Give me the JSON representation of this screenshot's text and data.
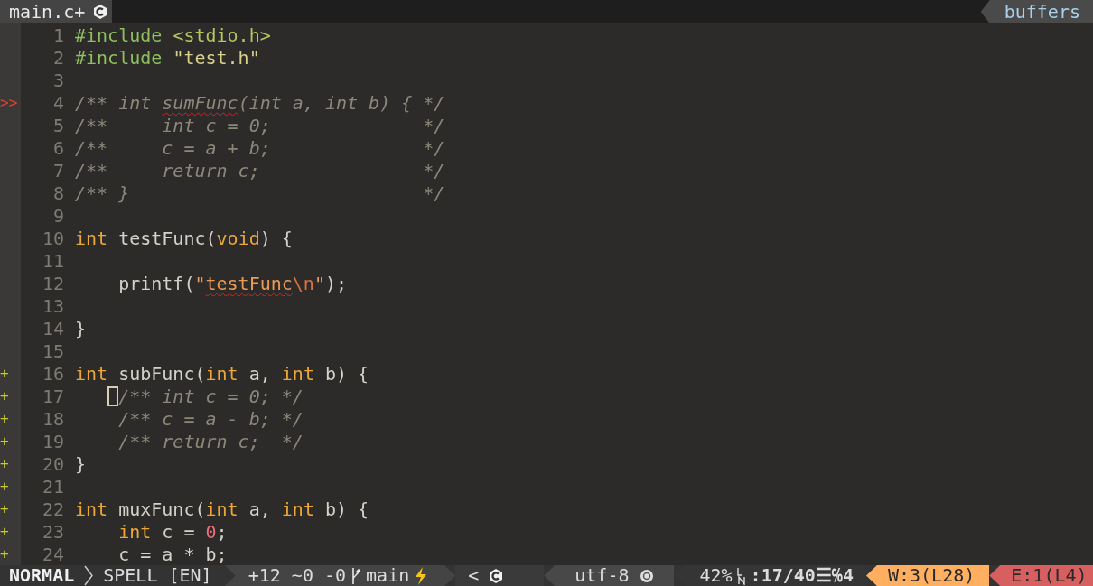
{
  "tabline": {
    "buffer": {
      "label": "main.c+",
      "selected": true
    },
    "right_label": "buffers"
  },
  "editor": {
    "lines": [
      {
        "number": "1",
        "segments": [
          {
            "kind": "preproc",
            "text": "#include "
          },
          {
            "kind": "include",
            "text": "<stdio.h>"
          }
        ]
      },
      {
        "number": "2",
        "segments": [
          {
            "kind": "preproc",
            "text": "#include "
          },
          {
            "kind": "header",
            "text": "\"test.h\""
          }
        ]
      },
      {
        "number": "3"
      },
      {
        "number": "4",
        "sign": {
          "kind": "error",
          "text": ">>"
        },
        "segments": [
          {
            "kind": "comment",
            "text": "/** int "
          },
          {
            "kind": "badcomment",
            "text": "sumFunc"
          },
          {
            "kind": "comment",
            "text": "(int a, int b) { */"
          }
        ]
      },
      {
        "number": "5",
        "segments": [
          {
            "kind": "comment",
            "text": "/**     int c = 0;              */"
          }
        ]
      },
      {
        "number": "6",
        "segments": [
          {
            "kind": "comment",
            "text": "/**     c = a + b;              */"
          }
        ]
      },
      {
        "number": "7",
        "segments": [
          {
            "kind": "comment",
            "text": "/**     return c;               */"
          }
        ]
      },
      {
        "number": "8",
        "segments": [
          {
            "kind": "comment",
            "text": "/** }                           */"
          }
        ]
      },
      {
        "number": "9"
      },
      {
        "number": "10",
        "segments": [
          {
            "kind": "keyword",
            "text": "int"
          },
          {
            "kind": "plain",
            "text": " testFunc("
          },
          {
            "kind": "keyword",
            "text": "void"
          },
          {
            "kind": "plain",
            "text": ") {"
          }
        ]
      },
      {
        "number": "11"
      },
      {
        "number": "12",
        "segments": [
          {
            "kind": "plain",
            "text": "    printf("
          },
          {
            "kind": "string",
            "text": "\""
          },
          {
            "kind": "badstring",
            "text": "testFunc"
          },
          {
            "kind": "escape",
            "text": "\\n"
          },
          {
            "kind": "string",
            "text": "\""
          },
          {
            "kind": "plain",
            "text": ");"
          }
        ]
      },
      {
        "number": "13"
      },
      {
        "number": "14",
        "segments": [
          {
            "kind": "plain",
            "text": "}"
          }
        ]
      },
      {
        "number": "15"
      },
      {
        "number": "16",
        "sign": {
          "kind": "added",
          "text": "+"
        },
        "segments": [
          {
            "kind": "keyword",
            "text": "int"
          },
          {
            "kind": "plain",
            "text": " subFunc("
          },
          {
            "kind": "keyword",
            "text": "int"
          },
          {
            "kind": "plain",
            "text": " a, "
          },
          {
            "kind": "keyword",
            "text": "int"
          },
          {
            "kind": "plain",
            "text": " b) {"
          }
        ]
      },
      {
        "number": "17",
        "sign": {
          "kind": "added",
          "text": "+"
        },
        "segments": [
          {
            "kind": "cursor"
          },
          {
            "kind": "comment",
            "text": "    /** int c = 0; */"
          }
        ]
      },
      {
        "number": "18",
        "sign": {
          "kind": "added",
          "text": "+"
        },
        "segments": [
          {
            "kind": "comment",
            "text": "    /** c = a - b; */"
          }
        ]
      },
      {
        "number": "19",
        "sign": {
          "kind": "added",
          "text": "+"
        },
        "segments": [
          {
            "kind": "comment",
            "text": "    /** return c;  */"
          }
        ]
      },
      {
        "number": "20",
        "sign": {
          "kind": "added",
          "text": "+"
        },
        "segments": [
          {
            "kind": "plain",
            "text": "}"
          }
        ]
      },
      {
        "number": "21",
        "sign": {
          "kind": "added",
          "text": "+"
        }
      },
      {
        "number": "22",
        "sign": {
          "kind": "added",
          "text": "+"
        },
        "segments": [
          {
            "kind": "keyword",
            "text": "int"
          },
          {
            "kind": "plain",
            "text": " muxFunc("
          },
          {
            "kind": "keyword",
            "text": "int"
          },
          {
            "kind": "plain",
            "text": " a, "
          },
          {
            "kind": "keyword",
            "text": "int"
          },
          {
            "kind": "plain",
            "text": " b) {"
          }
        ]
      },
      {
        "number": "23",
        "sign": {
          "kind": "added",
          "text": "+"
        },
        "segments": [
          {
            "kind": "keyword",
            "text": "    int"
          },
          {
            "kind": "plain",
            "text": " c = "
          },
          {
            "kind": "number",
            "text": "0"
          },
          {
            "kind": "plain",
            "text": ";"
          }
        ]
      },
      {
        "number": "24",
        "sign": {
          "kind": "added",
          "text": "+"
        },
        "segments": [
          {
            "kind": "plain",
            "text": "    c = a * b;"
          }
        ]
      }
    ]
  },
  "status_bar": {
    "mode": "NORMAL",
    "spell": "SPELL [EN]",
    "hunks": "+12 ~0 -0",
    "branch": "main",
    "filetype_marker": "<",
    "encoding": "utf-8",
    "percent": "42%",
    "position": ":17/40☰℅4",
    "warnings": "W:3(L28)",
    "errors": "E:1(L4)"
  }
}
